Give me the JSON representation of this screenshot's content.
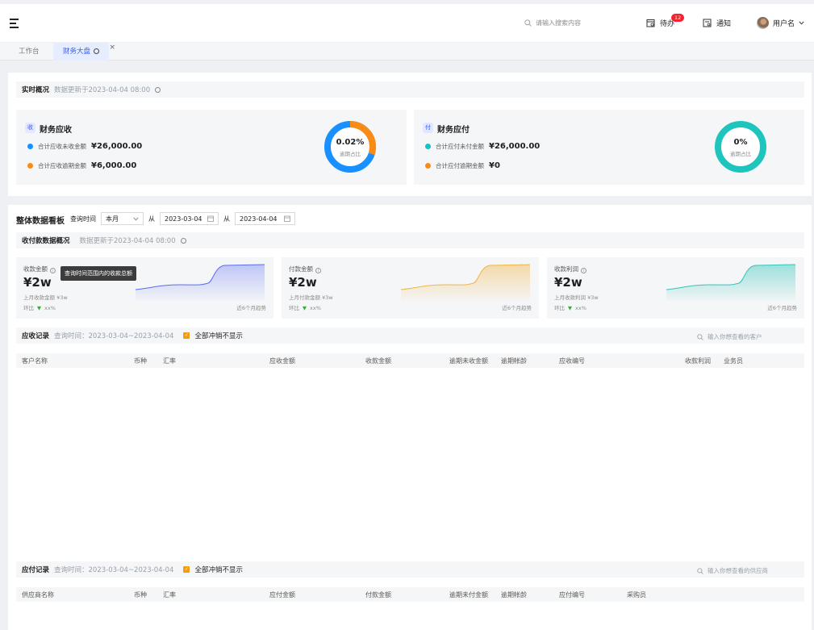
{
  "header": {
    "search_placeholder": "请输入搜索内容",
    "todo_label": "待办",
    "todo_count": "12",
    "notify_label": "通知",
    "user_name": "用户名"
  },
  "tabs": [
    {
      "label": "工作台"
    },
    {
      "label": "财务大盘"
    }
  ],
  "overview": {
    "title": "实时概况",
    "updated": "数据更新于2023-04-04 08:00",
    "receivable": {
      "chip": "收",
      "title": "财务应收",
      "row1_label": "合计应收未收金额",
      "row1_value": "¥26,000.00",
      "row2_label": "合计应收逾期金额",
      "row2_value": "¥6,000.00",
      "pct": "0.02%",
      "pct_label": "逾期占比",
      "ratio": 0.3
    },
    "payable": {
      "chip": "付",
      "title": "财务应付",
      "row1_label": "合计应付未付金额",
      "row1_value": "¥26,000.00",
      "row2_label": "合计应付逾期金额",
      "row2_value": "¥0",
      "pct": "0%",
      "pct_label": "逾期占比",
      "ratio": 0
    }
  },
  "board": {
    "title": "整体数据看板",
    "query_label": "查询时间",
    "period": "本月",
    "from_label": "从",
    "start_date": "2023-03-04",
    "end_date": "2023-04-04",
    "sub_title": "收付款数据概况",
    "sub_updated": "数据更新于2023-04-04 08:00",
    "tooltip": "查询时间范围内的收款总额",
    "kpis": [
      {
        "label": "收款金额",
        "value": "¥2w",
        "prev": "上月收款金额 ¥3w",
        "ratio_label": "环比",
        "ratio": "xx%",
        "trend": "近6个月趋势",
        "color": "#5b6cf0"
      },
      {
        "label": "付款金额",
        "value": "¥2w",
        "prev": "上月付款金额 ¥3w",
        "ratio_label": "环比",
        "ratio": "xx%",
        "trend": "近6个月趋势",
        "color": "#f0b64a"
      },
      {
        "label": "收款利润",
        "value": "¥2w",
        "prev": "上月收款利润 ¥3w",
        "ratio_label": "环比",
        "ratio": "xx%",
        "trend": "近6个月趋势",
        "color": "#34c4b8"
      }
    ]
  },
  "receivables": {
    "title": "应收记录",
    "range": "查询时间：2023-03-04~2023-04-04",
    "check_label": "全部冲销不显示",
    "search_placeholder": "输入你想查看的客户",
    "columns": [
      "客户名称",
      "币种",
      "汇率",
      "应收金额",
      "收款金额",
      "逾期未收金额",
      "逾期帐龄",
      "应收编号",
      "收款利润",
      "业务员"
    ]
  },
  "payables": {
    "title": "应付记录",
    "range": "查询时间：2023-03-04~2023-04-04",
    "check_label": "全部冲销不显示",
    "search_placeholder": "输入你想查看的供应商",
    "columns": [
      "供应商名称",
      "币种",
      "汇率",
      "应付金额",
      "付款金额",
      "逾期未付金额",
      "逾期帐龄",
      "应付编号",
      "采购员"
    ]
  }
}
